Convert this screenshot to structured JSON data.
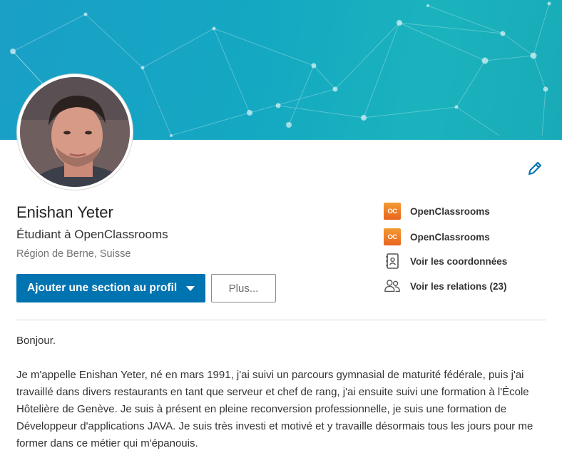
{
  "profile": {
    "name": "Enishan Yeter",
    "headline": "Étudiant à OpenClassrooms",
    "location": "Région de Berne, Suisse"
  },
  "actions": {
    "add_section_label": "Ajouter une section au profil",
    "more_label": "Plus..."
  },
  "sidebar": {
    "items": [
      {
        "label": "OpenClassrooms",
        "icon": "openclassrooms-logo",
        "logo_text": "OC"
      },
      {
        "label": "OpenClassrooms",
        "icon": "openclassrooms-logo",
        "logo_text": "OC"
      },
      {
        "label": "Voir les coordonnées",
        "icon": "contact-card-icon"
      },
      {
        "label": "Voir les relations (23)",
        "icon": "people-icon"
      }
    ]
  },
  "about": {
    "greeting": "Bonjour.",
    "body": "Je m'appelle Enishan Yeter, né en mars 1991, j'ai suivi un parcours gymnasial de maturité fédérale, puis j'ai travaillé dans divers restaurants en tant que serveur et chef de rang, j'ai ensuite suivi une formation à l'École Hôtelière de Genève. Je suis à présent en pleine reconversion professionnelle, je suis une formation de Développeur d'applications JAVA. Je suis très investi et motivé et y travaille désormais tous les jours pour me former dans ce métier qui m'épanouis."
  },
  "colors": {
    "primary": "#0073b1",
    "banner": "#17a6c2"
  }
}
